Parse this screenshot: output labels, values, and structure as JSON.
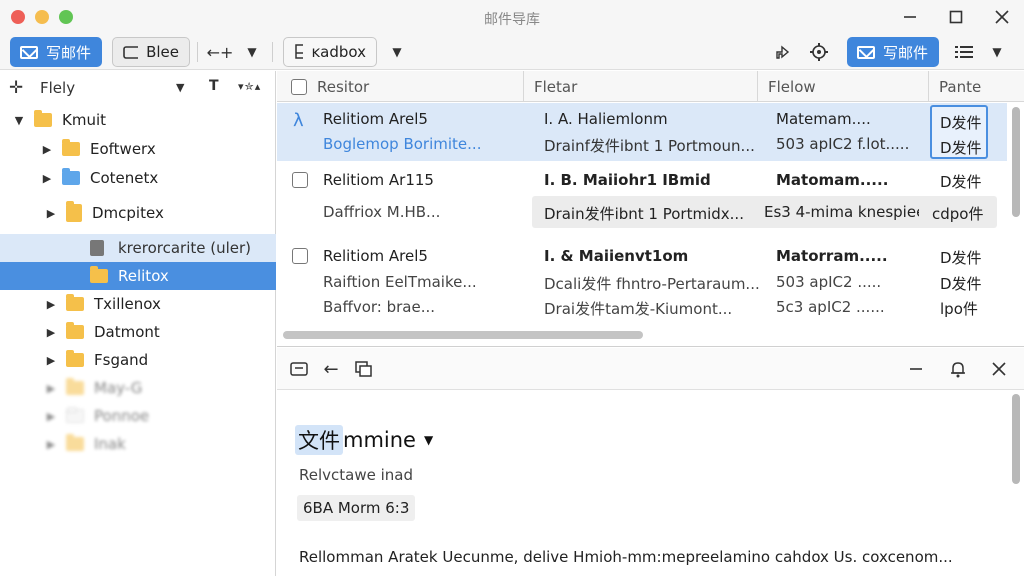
{
  "window": {
    "title": "邮件导库",
    "minimize_icon": "minimize-icon",
    "maximize_icon": "maximize-icon",
    "close_icon": "close-icon"
  },
  "toolbar": {
    "compose_label": "写邮件",
    "blee_label": "Blee",
    "forward_label": "←+",
    "inbox_label": "ĸadbox",
    "compose2_label": "写邮件"
  },
  "sidebar": {
    "header_label": "Flely",
    "items": [
      {
        "label": "Kmuit"
      },
      {
        "label": "Eoftwerx"
      },
      {
        "label": "Cotenetx"
      },
      {
        "label": "Dmcpitex"
      },
      {
        "label": "krerorcarite (uler)"
      },
      {
        "label": "Relitox"
      },
      {
        "label": "Txillenox"
      },
      {
        "label": "Datmont"
      },
      {
        "label": "Fsgand"
      },
      {
        "label": "May-G"
      },
      {
        "label": "Ponnoe"
      },
      {
        "label": "Inak"
      }
    ]
  },
  "list": {
    "columns": [
      "Resitor",
      "Fletar",
      "Flelow",
      "Pante"
    ],
    "rows": [
      {
        "sender": "Relitiom Arel5",
        "sender2": "Boglemop Borimite...",
        "subject": "I. A. Haliemlonm",
        "subject2": "Drainf发件ibnt 1 Portmoun...",
        "flow": "Matemam....",
        "flow2": "503 apIC2 f.lot.....",
        "pane": "D发件",
        "pane2": "D发件"
      },
      {
        "sender": "Relitiom Ar115",
        "sender2": "Daffriox M.HB...",
        "subject": "I. B. Maiiohr1 IBmid",
        "subject2": "Drain发件ibnt 1 Portmidx...",
        "flow": "Matomam.....",
        "flow2": "Es3 4-mima knespiee",
        "pane": "D发件",
        "pane2": "cdpo件"
      },
      {
        "sender": "Relitiom Arel5",
        "sender2": "Raiftion EelTmaike...",
        "sender3": "Baffvor: brae...",
        "subject": "I. & Maiienvt1om",
        "subject2": "Dcali发件 fhntro-Pertaraum...",
        "subject3": "Drai发件tam发-Kiumont...",
        "flow": "Matorram.....",
        "flow2": "503 apIC2 .....",
        "flow3": "5c3 apIC2 ......",
        "pane": "D发件",
        "pane2": "D发件",
        "pane3": "lpo件"
      }
    ]
  },
  "reader": {
    "subject_cjk": "文件",
    "subject_rest": "mmine",
    "sender_line": "Relvctawe inad",
    "badge": "6BA Morm 6:3",
    "body": "Rellomman Aratek Uecunme, delive Hmioh-mm:mepreelamino cahdox Us. coxcenom..."
  },
  "colors": {
    "accent": "#3f86dc",
    "selection": "#4a8fe0",
    "row_highlight": "#dbe8f8"
  }
}
